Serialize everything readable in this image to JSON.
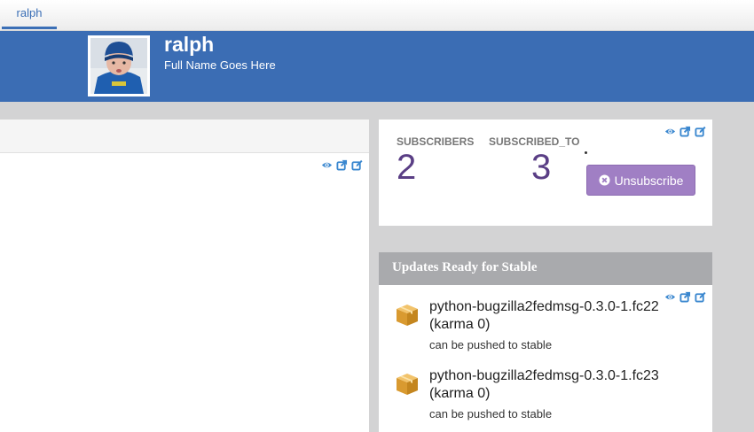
{
  "tabs": [
    {
      "label": "ralph"
    }
  ],
  "profile": {
    "username": "ralph",
    "full_name": "Full Name Goes Here"
  },
  "subscriptions": {
    "subscribers_label": "SUBSCRIBERS",
    "subscribers_count": "2",
    "subscribed_to_label": "SUBSCRIBED_TO",
    "subscribed_to_count": "3",
    "unsubscribe_label": "Unsubscribe"
  },
  "updates": {
    "title": "Updates Ready for Stable",
    "items": [
      {
        "name": "python-bugzilla2fedmsg-0.3.0-1.fc22 (karma 0)",
        "status": "can be pushed to stable"
      },
      {
        "name": "python-bugzilla2fedmsg-0.3.0-1.fc23 (karma 0)",
        "status": "can be pushed to stable"
      }
    ]
  },
  "widget_tools": [
    "eye-icon",
    "external-link-icon",
    "edit-icon"
  ],
  "colors": {
    "brand_blue": "#3b6db4",
    "accent_purple": "#5a3e85",
    "button_purple": "#a07fc4",
    "tool_blue": "#3a87cf"
  }
}
